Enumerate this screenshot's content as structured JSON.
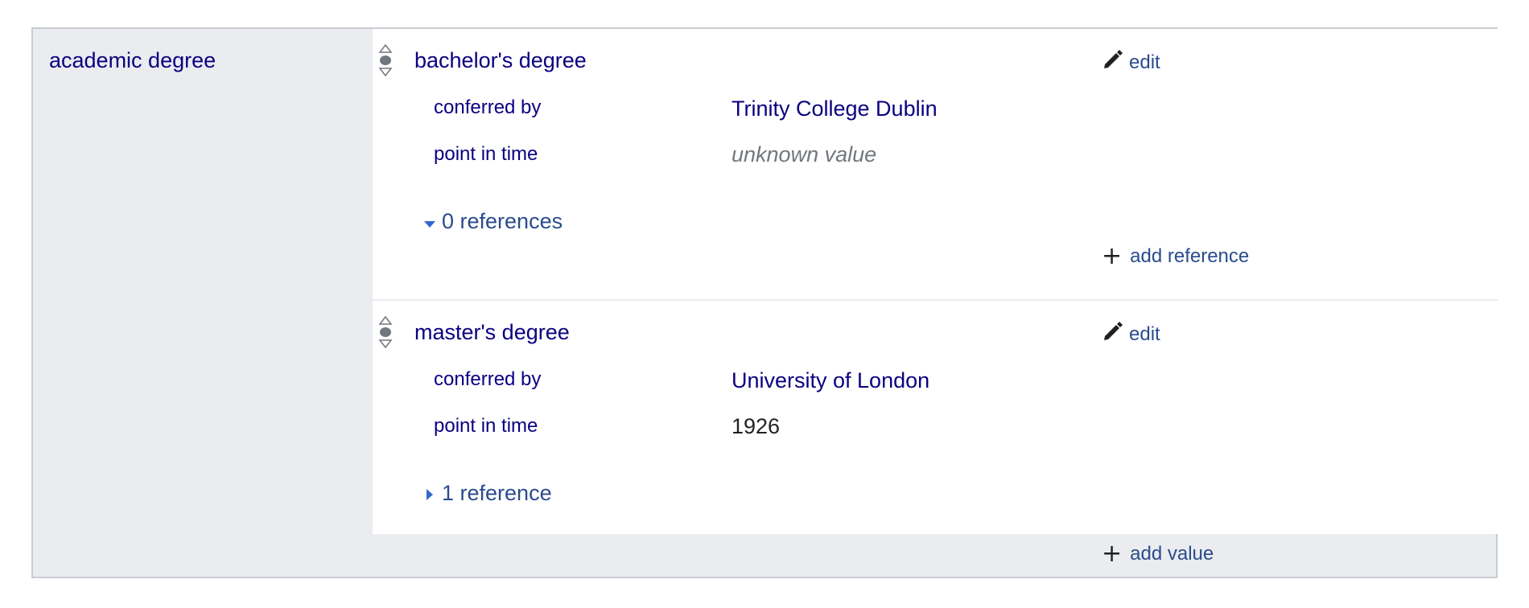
{
  "property": {
    "label": "academic degree"
  },
  "statements": [
    {
      "value": "bachelor's degree",
      "edit_label": "edit",
      "qualifiers": [
        {
          "property": "conferred by",
          "value": "Trinity College Dublin"
        },
        {
          "property": "point in time",
          "value": "unknown value"
        }
      ],
      "references_label": "0 references",
      "references_expanded": true,
      "add_reference_label": "add reference"
    },
    {
      "value": "master's degree",
      "edit_label": "edit",
      "qualifiers": [
        {
          "property": "conferred by",
          "value": "University of London"
        },
        {
          "property": "point in time",
          "value": "1926"
        }
      ],
      "references_label": "1 reference",
      "references_expanded": false
    }
  ],
  "add_value_label": "add value",
  "icons": {
    "rank": "rank-selector-icon",
    "edit": "pencil-icon",
    "add": "plus-icon",
    "expand": "triangle-down-icon",
    "collapse": "triangle-right-icon"
  },
  "colors": {
    "link": "#0b0080",
    "action": "#2a4b8d",
    "unknown": "#72777d",
    "group_bg": "#eaecf0",
    "border": "#c8ccd1"
  }
}
